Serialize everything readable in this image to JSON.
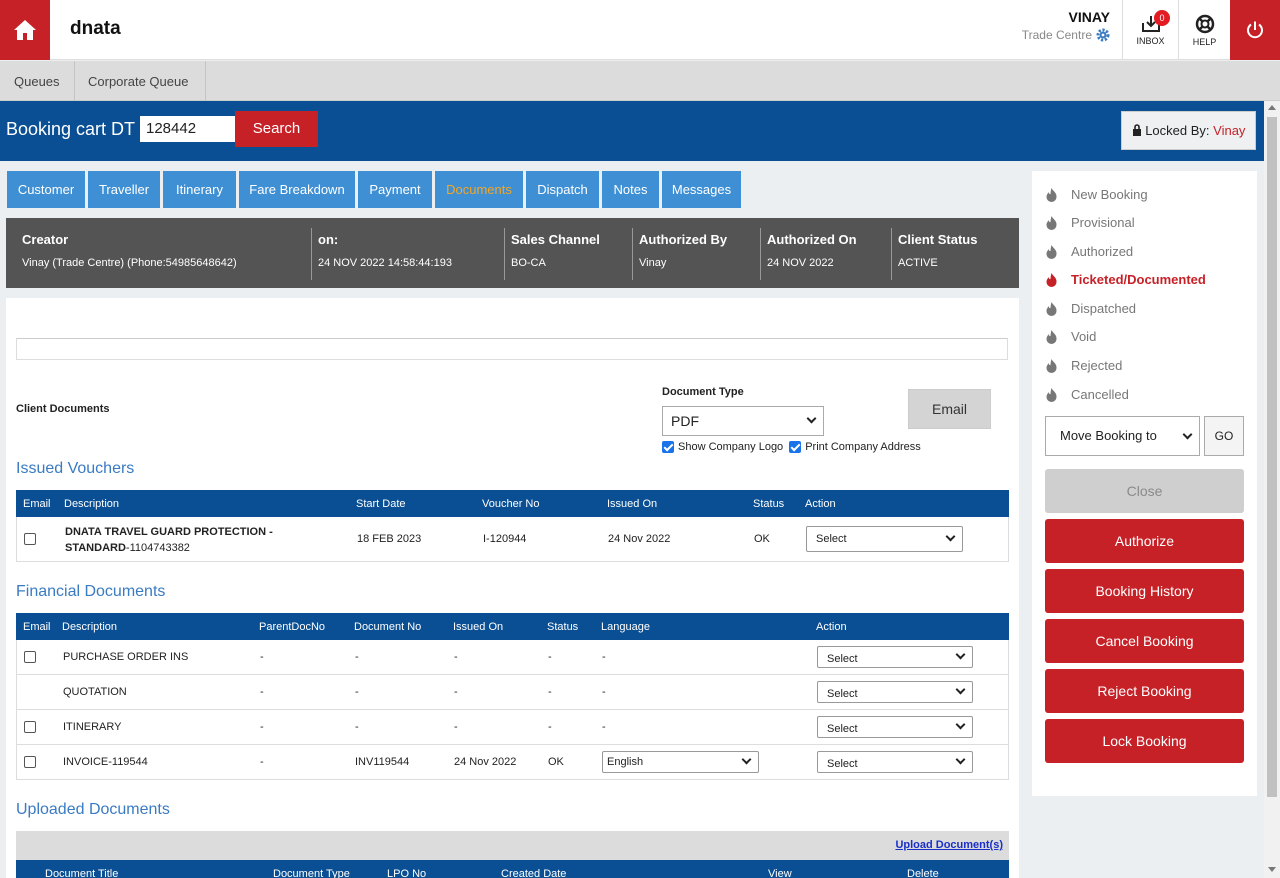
{
  "header": {
    "brand": "dnata",
    "user_name": "VINAY",
    "user_role": "Trade Centre",
    "inbox_label": "INBOX",
    "inbox_count": "0",
    "help_label": "HELP"
  },
  "subnav": {
    "items": [
      "Queues",
      "Corporate Queue"
    ]
  },
  "booking": {
    "label": "Booking cart DT",
    "number": "128442",
    "search_label": "Search",
    "locked_prefix": "Locked By:",
    "locked_by": "Vinay"
  },
  "tabs": [
    "Customer",
    "Traveller",
    "Itinerary",
    "Fare Breakdown",
    "Payment",
    "Documents",
    "Dispatch",
    "Notes",
    "Messages"
  ],
  "active_tab": "Documents",
  "info": {
    "creator_h": "Creator",
    "creator_v": "Vinay (Trade Centre) (Phone:54985648642)",
    "on_h": "on:",
    "on_v": "24 NOV 2022 14:58:44:193",
    "channel_h": "Sales Channel",
    "channel_v": "BO-CA",
    "authby_h": "Authorized By",
    "authby_v": "Vinay",
    "authon_h": "Authorized On",
    "authon_v": "24 NOV 2022",
    "client_h": "Client Status",
    "client_v": "ACTIVE"
  },
  "documents": {
    "client_docs_label": "Client Documents",
    "doc_type_label": "Document Type",
    "doc_type_value": "PDF",
    "email_button": "Email",
    "show_logo_label": "Show Company Logo",
    "print_address_label": "Print Company Address"
  },
  "vouchers": {
    "title": "Issued Vouchers",
    "headers": {
      "email": "Email",
      "description": "Description",
      "start": "Start Date",
      "voucher": "Voucher No",
      "issued": "Issued On",
      "status": "Status",
      "action": "Action"
    },
    "row": {
      "desc_bold": "DNATA TRAVEL GUARD PROTECTION - STANDARD",
      "desc_id": "-1104743382",
      "start": "18 FEB 2023",
      "voucher": "I-120944",
      "issued": "24 Nov 2022",
      "status": "OK",
      "action": "Select"
    }
  },
  "financial": {
    "title": "Financial Documents",
    "headers": {
      "email": "Email",
      "description": "Description",
      "parent": "ParentDocNo",
      "docno": "Document No",
      "issued": "Issued On",
      "status": "Status",
      "language": "Language",
      "action": "Action"
    },
    "rows": [
      {
        "desc": "PURCHASE ORDER INS",
        "parent": "-",
        "docno": "-",
        "issued": "-",
        "status": "-",
        "language": "-",
        "action": "Select"
      },
      {
        "desc": "QUOTATION",
        "parent": "-",
        "docno": "-",
        "issued": "-",
        "status": "-",
        "language": "-",
        "action": "Select"
      },
      {
        "desc": "ITINERARY",
        "parent": "-",
        "docno": "-",
        "issued": "-",
        "status": "-",
        "language": "-",
        "action": "Select"
      },
      {
        "desc": "INVOICE-119544",
        "parent": "-",
        "docno": "INV119544",
        "issued": "24 Nov 2022",
        "status": "OK",
        "language": "English",
        "action": "Select"
      }
    ]
  },
  "uploaded": {
    "title": "Uploaded Documents",
    "upload_link": "Upload Document(s)",
    "headers": {
      "title": "Document Title",
      "type": "Document Type",
      "lpo": "LPO No",
      "created": "Created Date",
      "view": "View",
      "delete": "Delete"
    }
  },
  "status_list": [
    "New Booking",
    "Provisional",
    "Authorized",
    "Ticketed/Documented",
    "Dispatched",
    "Void",
    "Rejected",
    "Cancelled"
  ],
  "current_status": "Ticketed/Documented",
  "actions": {
    "move_label": "Move Booking to",
    "go_label": "GO",
    "close": "Close",
    "authorize": "Authorize",
    "history": "Booking History",
    "cancel": "Cancel Booking",
    "reject": "Reject Booking",
    "lock": "Lock Booking"
  },
  "colors": {
    "brand_red": "#c62127",
    "header_blue": "#0a4f93",
    "tab_blue": "#3f8fd4",
    "active_tab": "#f5a623"
  }
}
